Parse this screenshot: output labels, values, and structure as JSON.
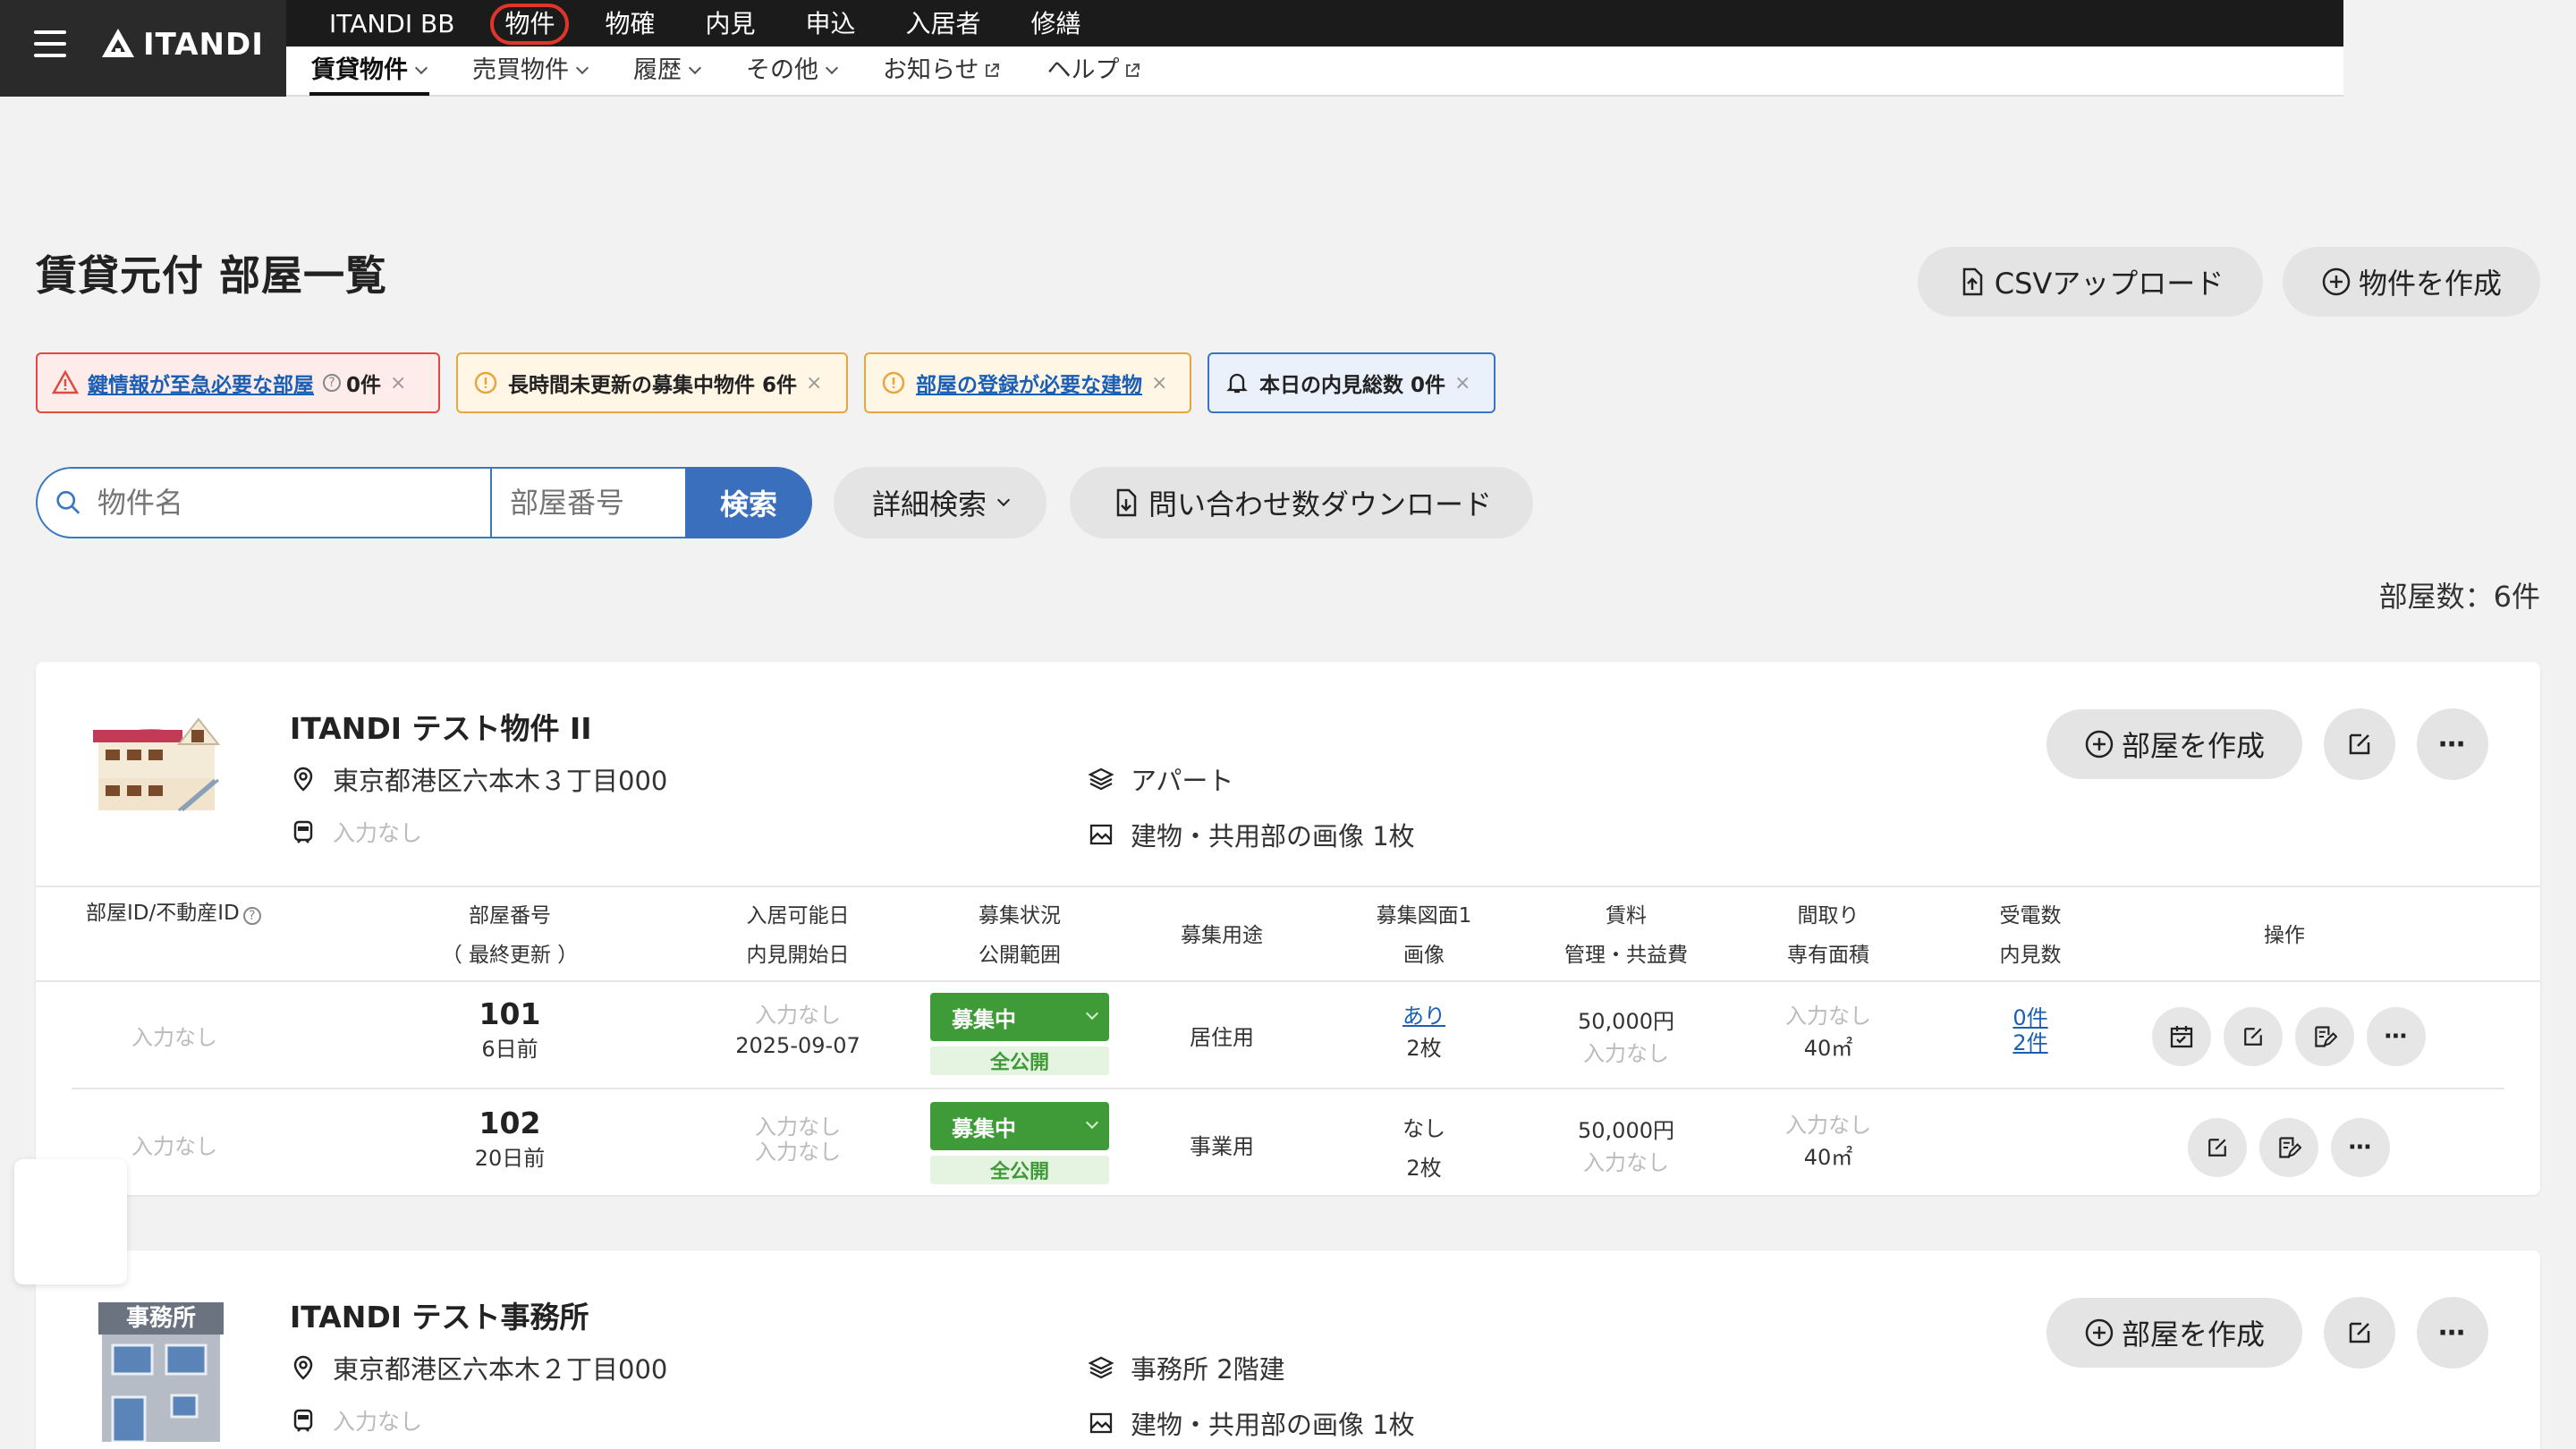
{
  "header": {
    "logo_text": "ITANDI",
    "top_nav": [
      "ITANDI BB",
      "物件",
      "物確",
      "内見",
      "申込",
      "入居者",
      "修繕"
    ],
    "sub_nav": [
      {
        "label": "賃貸物件",
        "type": "dropdown"
      },
      {
        "label": "売買物件",
        "type": "dropdown"
      },
      {
        "label": "履歴",
        "type": "dropdown"
      },
      {
        "label": "その他",
        "type": "dropdown"
      },
      {
        "label": "お知らせ",
        "type": "external"
      },
      {
        "label": "ヘルプ",
        "type": "external"
      }
    ]
  },
  "page": {
    "title": "賃貸元付  部屋一覧",
    "csv_upload": "CSVアップロード",
    "create_property": "物件を作成"
  },
  "alerts": [
    {
      "label": "鍵情報が至急必要な部屋",
      "count": "0件",
      "close": "×",
      "level": "red"
    },
    {
      "label": "長時間未更新の募集中物件 6件",
      "close": "×",
      "level": "orange"
    },
    {
      "label": "部屋の登録が必要な建物",
      "close": "×",
      "level": "orange"
    },
    {
      "label": "本日の内見総数 0件",
      "close": "×",
      "level": "blue"
    }
  ],
  "search": {
    "name_placeholder": "物件名",
    "room_placeholder": "部屋番号",
    "search_button": "検索",
    "detail_search": "詳細検索",
    "download_inquiries": "問い合わせ数ダウンロード"
  },
  "room_count": "部屋数：6件",
  "table_headers": {
    "room_id": "部屋ID/不動産ID",
    "room_no": "部屋番号",
    "room_no_sub": "（ 最終更新 ）",
    "available": "入居可能日",
    "available_sub": "内見開始日",
    "status": "募集状況",
    "status_sub": "公開範囲",
    "usage": "募集用途",
    "floorplan": "募集図面1",
    "floorplan_sub": "画像",
    "rent": "賃料",
    "rent_sub": "管理・共益費",
    "layout": "間取り",
    "layout_sub": "専有面積",
    "calls": "受電数",
    "calls_sub": "内見数",
    "ops": "操作"
  },
  "properties": [
    {
      "name": "ITANDI テスト物件 II",
      "address": "東京都港区六本木３丁目000",
      "station": "入力なし",
      "type": "アパート",
      "images": "建物・共用部の画像 1枚",
      "create_room": "部屋を作成",
      "more": "⋯",
      "rooms": [
        {
          "room_id": "入力なし",
          "room_no": "101",
          "updated": "6日前",
          "available": "入力なし",
          "viewing_start": "2025-09-07",
          "status": "募集中",
          "publish": "全公開",
          "usage": "居住用",
          "floorplan": "あり",
          "image_count": "2枚",
          "rent": "50,000円",
          "fee": "入力なし",
          "layout": "入力なし",
          "area": "40㎡",
          "calls": "0件",
          "viewings": "2件",
          "more": "⋯"
        },
        {
          "room_id": "入力なし",
          "room_no": "102",
          "updated": "20日前",
          "available": "入力なし",
          "viewing_start": "入力なし",
          "status": "募集中",
          "publish": "全公開",
          "usage": "事業用",
          "floorplan": "なし",
          "image_count": "2枚",
          "rent": "50,000円",
          "fee": "入力なし",
          "layout": "入力なし",
          "area": "40㎡",
          "more": "⋯"
        }
      ]
    },
    {
      "name": "ITANDI テスト事務所",
      "address": "東京都港区六本木２丁目000",
      "station": "入力なし",
      "type": "事務所 2階建",
      "images": "建物・共用部の画像 1枚",
      "create_room": "部屋を作成",
      "more": "⋯",
      "sign_text": "事務所"
    }
  ],
  "colors": {
    "accent_blue": "#3a6fbd",
    "status_green": "#3f9b37",
    "alert_red": "#e04a3f",
    "alert_orange": "#e8a640",
    "active_nav_ring": "#e0352b"
  }
}
